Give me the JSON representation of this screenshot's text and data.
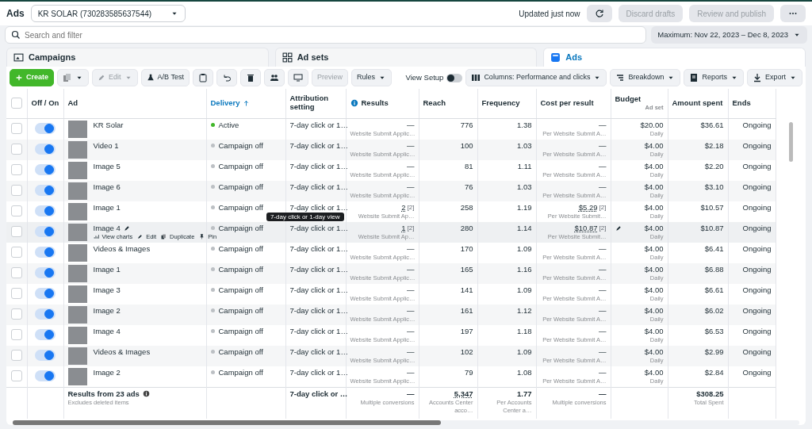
{
  "header": {
    "title": "Ads",
    "account": "KR SOLAR (730283585637544)",
    "status": "Updated just now",
    "buttons": [
      {
        "label": "Discard drafts",
        "disabled": true
      },
      {
        "label": "Review and publish",
        "disabled": true
      }
    ]
  },
  "search": {
    "placeholder": "Search and filter"
  },
  "date_range": "Maximum: Nov 22, 2023 – Dec 8, 2023",
  "tabs": [
    {
      "label": "Campaigns",
      "selected": false
    },
    {
      "label": "Ad sets",
      "selected": false
    },
    {
      "label": "Ads",
      "selected": true
    }
  ],
  "toolbar": {
    "create": "Create",
    "edit": {
      "label": "Edit",
      "disabled": true
    },
    "ab_test": "A/B Test",
    "preview": {
      "label": "Preview",
      "disabled": true
    },
    "rules": "Rules",
    "view_setup": {
      "label": "View Setup",
      "on": false
    },
    "columns": "Columns: Performance and clicks",
    "breakdown": "Breakdown",
    "reports": "Reports",
    "export": "Export"
  },
  "table": {
    "select_all": {
      "checked": false
    },
    "columns": [
      {
        "label": "Off / On",
        "sorted": false
      },
      {
        "label": "Ad",
        "sorted": false
      },
      {
        "label": "Delivery",
        "sorted": true
      },
      {
        "label": "Attribution setting",
        "sorted": false
      },
      {
        "label": "Results",
        "sorted": false
      },
      {
        "label": "Reach",
        "sorted": false
      },
      {
        "label": "Frequency",
        "sorted": false
      },
      {
        "label": "Cost per result",
        "sorted": false
      },
      {
        "label": "Budget",
        "sub": "Ad set",
        "sorted": false
      },
      {
        "label": "Amount spent",
        "sorted": false
      },
      {
        "label": "Ends",
        "sorted": false
      }
    ],
    "rows": [
      {
        "selected": false,
        "on": true,
        "name": "KR Solar",
        "hovered": false,
        "delivery": "Active",
        "color": "#42b72a",
        "attribution": "7-day click or 1…",
        "results": "—",
        "results_sub": "Website Submit Applic…",
        "reach": "776",
        "frequency": "1.38",
        "cost": "—",
        "cost_sub": "Per Website Submit A…",
        "budget": "$20.00",
        "budget_sub": "Daily",
        "spent": "$36.61",
        "ends": "Ongoing"
      },
      {
        "selected": false,
        "on": true,
        "name": "Video 1",
        "hovered": false,
        "delivery": "Campaign off",
        "color": "#bcc0c4",
        "attribution": "7-day click or 1…",
        "results": "—",
        "results_sub": "Website Submit Applic…",
        "reach": "100",
        "frequency": "1.03",
        "cost": "—",
        "cost_sub": "Per Website Submit A…",
        "budget": "$4.00",
        "budget_sub": "Daily",
        "spent": "$2.18",
        "ends": "Ongoing"
      },
      {
        "selected": false,
        "on": true,
        "name": "Image 5",
        "hovered": false,
        "delivery": "Campaign off",
        "color": "#bcc0c4",
        "attribution": "7-day click or 1…",
        "results": "—",
        "results_sub": "Website Submit Applic…",
        "reach": "81",
        "frequency": "1.11",
        "cost": "—",
        "cost_sub": "Per Website Submit A…",
        "budget": "$4.00",
        "budget_sub": "Daily",
        "spent": "$2.20",
        "ends": "Ongoing"
      },
      {
        "selected": false,
        "on": true,
        "name": "Image 6",
        "hovered": false,
        "delivery": "Campaign off",
        "color": "#bcc0c4",
        "attribution": "7-day click or 1…",
        "results": "—",
        "results_sub": "Website Submit Applic…",
        "reach": "76",
        "frequency": "1.03",
        "cost": "—",
        "cost_sub": "Per Website Submit A…",
        "budget": "$4.00",
        "budget_sub": "Daily",
        "spent": "$3.10",
        "ends": "Ongoing"
      },
      {
        "selected": false,
        "on": true,
        "name": "Image 1",
        "hovered": false,
        "delivery": "Campaign off",
        "color": "#bcc0c4",
        "attribution": "7-day click or 1…",
        "results": "2",
        "results_note": "[2]",
        "results_sub": "Website Submit Ap…",
        "reach": "258",
        "frequency": "1.19",
        "cost": "$5.29",
        "cost_note": "[2]",
        "cost_sub": "Per Website Submit…",
        "budget": "$4.00",
        "budget_sub": "Daily",
        "spent": "$10.57",
        "ends": "Ongoing"
      },
      {
        "selected": false,
        "on": true,
        "name": "Image 4",
        "hovered": true,
        "actions": [
          "View charts",
          "Edit",
          "Duplicate",
          "Pin"
        ],
        "delivery": "Campaign off",
        "color": "#bcc0c4",
        "attribution": "7-day click or 1…",
        "tooltip": "7-day click or 1-day view",
        "results": "1",
        "results_note": "[2]",
        "results_sub": "Website Submit Ap…",
        "reach": "280",
        "frequency": "1.14",
        "cost": "$10.87",
        "cost_note": "[2]",
        "cost_sub": "Per Website Submit…",
        "budget": "$4.00",
        "budget_sub": "Daily",
        "spent": "$10.87",
        "ends": "Ongoing"
      },
      {
        "selected": false,
        "on": true,
        "name": "Videos & Images",
        "hovered": false,
        "delivery": "Campaign off",
        "color": "#bcc0c4",
        "attribution": "7-day click or 1…",
        "results": "—",
        "results_sub": "Website Submit Applic…",
        "reach": "170",
        "frequency": "1.09",
        "cost": "—",
        "cost_sub": "Per Website Submit A…",
        "budget": "$4.00",
        "budget_sub": "Daily",
        "spent": "$6.41",
        "ends": "Ongoing"
      },
      {
        "selected": false,
        "on": true,
        "name": "Image 1",
        "hovered": false,
        "delivery": "Campaign off",
        "color": "#bcc0c4",
        "attribution": "7-day click or 1…",
        "results": "—",
        "results_sub": "Website Submit Applic…",
        "reach": "165",
        "frequency": "1.16",
        "cost": "—",
        "cost_sub": "Per Website Submit A…",
        "budget": "$4.00",
        "budget_sub": "Daily",
        "spent": "$6.88",
        "ends": "Ongoing"
      },
      {
        "selected": false,
        "on": true,
        "name": "Image 3",
        "hovered": false,
        "delivery": "Campaign off",
        "color": "#bcc0c4",
        "attribution": "7-day click or 1…",
        "results": "—",
        "results_sub": "Website Submit Applic…",
        "reach": "141",
        "frequency": "1.09",
        "cost": "—",
        "cost_sub": "Per Website Submit A…",
        "budget": "$4.00",
        "budget_sub": "Daily",
        "spent": "$6.61",
        "ends": "Ongoing"
      },
      {
        "selected": false,
        "on": true,
        "name": "Image 2",
        "hovered": false,
        "delivery": "Campaign off",
        "color": "#bcc0c4",
        "attribution": "7-day click or 1…",
        "results": "—",
        "results_sub": "Website Submit Applic…",
        "reach": "161",
        "frequency": "1.12",
        "cost": "—",
        "cost_sub": "Per Website Submit A…",
        "budget": "$4.00",
        "budget_sub": "Daily",
        "spent": "$6.02",
        "ends": "Ongoing"
      },
      {
        "selected": false,
        "on": true,
        "name": "Image 4",
        "hovered": false,
        "delivery": "Campaign off",
        "color": "#bcc0c4",
        "attribution": "7-day click or 1…",
        "results": "—",
        "results_sub": "Website Submit Applic…",
        "reach": "197",
        "frequency": "1.18",
        "cost": "—",
        "cost_sub": "Per Website Submit A…",
        "budget": "$4.00",
        "budget_sub": "Daily",
        "spent": "$6.53",
        "ends": "Ongoing"
      },
      {
        "selected": false,
        "on": true,
        "name": "Videos & Images",
        "hovered": false,
        "delivery": "Campaign off",
        "color": "#bcc0c4",
        "attribution": "7-day click or 1…",
        "results": "—",
        "results_sub": "Website Submit Applic…",
        "reach": "102",
        "frequency": "1.09",
        "cost": "—",
        "cost_sub": "Per Website Submit A…",
        "budget": "$4.00",
        "budget_sub": "Daily",
        "spent": "$2.99",
        "ends": "Ongoing"
      },
      {
        "selected": false,
        "on": true,
        "name": "Image 2",
        "hovered": false,
        "delivery": "Campaign off",
        "color": "#bcc0c4",
        "attribution": "7-day click or 1…",
        "results": "—",
        "results_sub": "Website Submit Applic…",
        "reach": "79",
        "frequency": "1.08",
        "cost": "—",
        "cost_sub": "Per Website Submit A…",
        "budget": "$4.00",
        "budget_sub": "Daily",
        "spent": "$2.84",
        "ends": "Ongoing"
      }
    ],
    "footer": {
      "label": "Results from 23 ads",
      "note": "Excludes deleted items",
      "attribution": "7-day click or …",
      "results": "—",
      "results_sub": "Multiple conversions",
      "reach": "5,347",
      "reach_sub": "Accounts Center acco…",
      "frequency": "1.77",
      "frequency_sub": "Per Accounts Center a…",
      "cost": "—",
      "cost_sub": "Multiple conversions",
      "spent": "$308.25",
      "spent_sub": "Total Spent"
    }
  }
}
